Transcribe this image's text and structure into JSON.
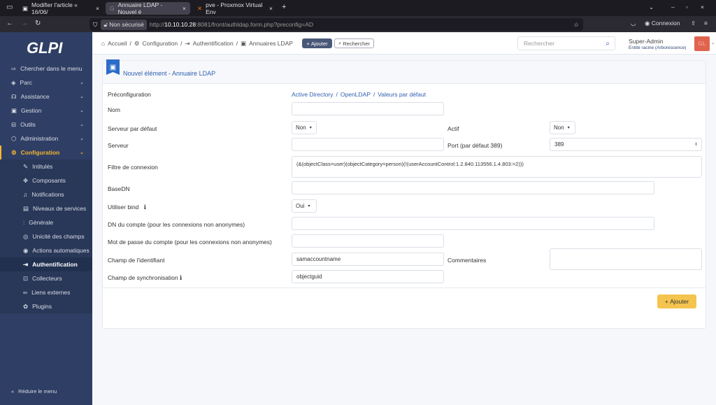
{
  "browser": {
    "tabs": [
      {
        "label": "Modifier l'article « 16/06/"
      },
      {
        "label": "Annuaire LDAP - Nouvel é"
      },
      {
        "label": "pve - Proxmox Virtual Env"
      }
    ],
    "security": "Non sécurisé",
    "url_prefix": "http://",
    "url_host": "10.10.10.28",
    "url_rest": ":8081/front/authldap.form.php?preconfig=AD",
    "connexion": "Connexion"
  },
  "sidebar": {
    "logo": "GLPI",
    "search": "Chercher dans le menu",
    "items": [
      {
        "label": "Parc"
      },
      {
        "label": "Assistance"
      },
      {
        "label": "Gestion"
      },
      {
        "label": "Outils"
      },
      {
        "label": "Administration"
      },
      {
        "label": "Configuration"
      }
    ],
    "subitems": [
      {
        "label": "Intitulés"
      },
      {
        "label": "Composants"
      },
      {
        "label": "Notifications"
      },
      {
        "label": "Niveaux de services"
      },
      {
        "label": "Générale"
      },
      {
        "label": "Unicité des champs"
      },
      {
        "label": "Actions automatiques"
      },
      {
        "label": "Authentification"
      },
      {
        "label": "Collecteurs"
      },
      {
        "label": "Liens externes"
      },
      {
        "label": "Plugins"
      }
    ],
    "collapse": "Réduire le menu",
    "accent": "#f4b731"
  },
  "header": {
    "breadcrumb": [
      "Accueil",
      "Configuration",
      "Authentification",
      "Annuaires LDAP"
    ],
    "add": "Ajouter",
    "search_btn": "Rechercher",
    "search_placeholder": "Rechercher",
    "user": "Super-Admin",
    "entity": "Entité racine (Arborescence)",
    "avatar": "GL",
    "avatar_color": "#e0634f"
  },
  "form": {
    "title": "Nouvel élément - Annuaire LDAP",
    "preconfig_label": "Préconfiguration",
    "preconfig_links": [
      "Active Directory",
      "OpenLDAP",
      "Valeurs par défaut"
    ],
    "nom": {
      "label": "Nom",
      "value": ""
    },
    "default_server": {
      "label": "Serveur par défaut",
      "value": "Non"
    },
    "actif": {
      "label": "Actif",
      "value": "Non"
    },
    "server": {
      "label": "Serveur",
      "value": ""
    },
    "port": {
      "label": "Port (par défaut 389)",
      "value": "389"
    },
    "filter": {
      "label": "Filtre de connexion",
      "value": "(&(objectClass=user)(objectCategory=person)(!(userAccountControl:1.2.840.113556.1.4.803:=2)))"
    },
    "basedn": {
      "label": "BaseDN",
      "value": ""
    },
    "bind": {
      "label": "Utiliser bind",
      "value": "Oui"
    },
    "dn": {
      "label": "DN du compte (pour les connexions non anonymes)",
      "value": ""
    },
    "password": {
      "label": "Mot de passe du compte (pour les connexions non anonymes)",
      "value": ""
    },
    "login_field": {
      "label": "Champ de l'identifiant",
      "value": "samaccountname"
    },
    "comments": {
      "label": "Commentaires",
      "value": ""
    },
    "sync_field": {
      "label": "Champ de synchronisation",
      "value": "objectguid"
    },
    "submit": "Ajouter"
  }
}
